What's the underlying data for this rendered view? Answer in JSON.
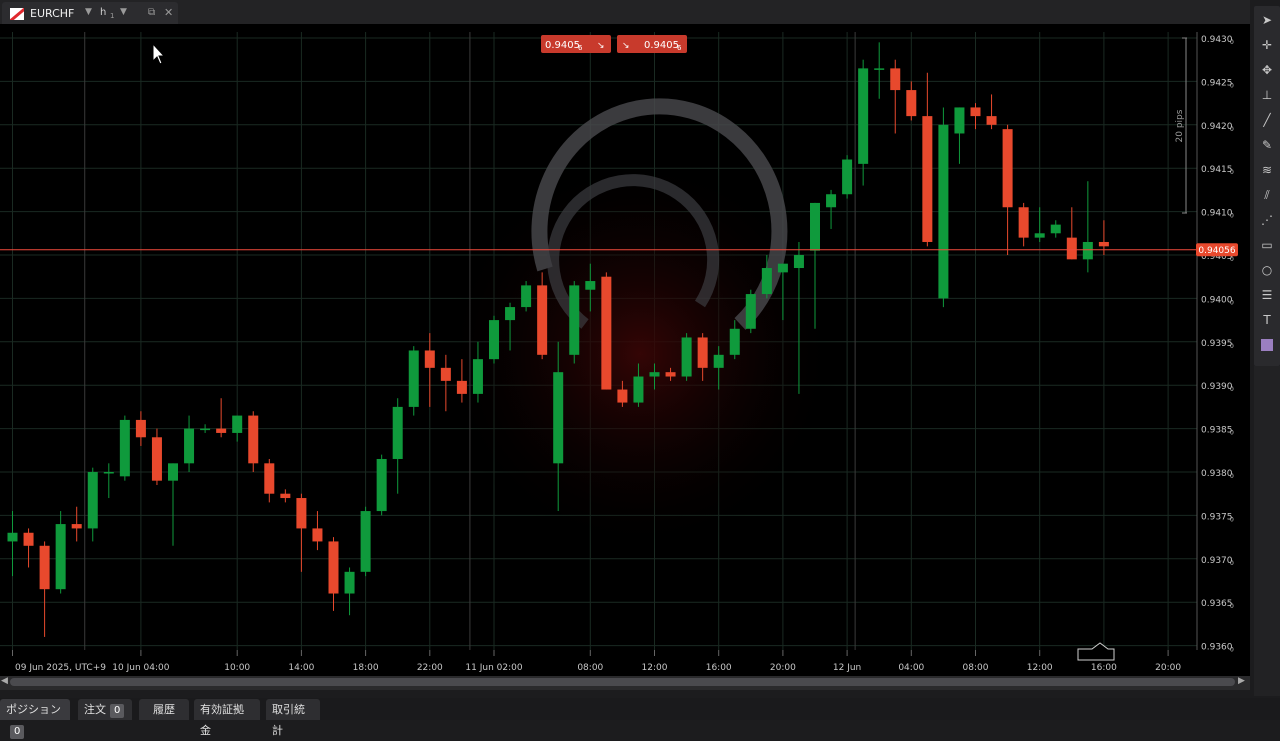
{
  "top_tab": {
    "symbol": "EURCHF",
    "timeframe": "h",
    "timeframe_sub": "1"
  },
  "colors": {
    "bull": "#0f9a3c",
    "bear": "#e8492d",
    "price_line": "#ef4b3c",
    "grid": "#1a2a22",
    "axis_text": "#c8c8c8"
  },
  "price_badges": {
    "sell": "0.9405",
    "sell_sub": "6",
    "buy": "0.9405",
    "buy_sub": "6"
  },
  "bottom_tabs": [
    {
      "label": "ポジション",
      "count": "0"
    },
    {
      "label": "注文",
      "count": "0"
    },
    {
      "label": "履歴"
    },
    {
      "label": "有効証拠金"
    },
    {
      "label": "取引統計"
    }
  ],
  "tools": [
    "cursor-icon",
    "crosshair-icon",
    "move-icon",
    "measure-icon",
    "trendline-icon",
    "brush-icon",
    "fibonacci-icon",
    "pitchfork-icon",
    "channel-icon",
    "rectangle-icon",
    "ellipse-icon",
    "equidistant-icon",
    "text-icon",
    "color-swatch-icon"
  ],
  "chart_data": {
    "type": "candlestick",
    "symbol": "EURCHF",
    "timeframe": "h1",
    "ylim": [
      0.93585,
      0.94305
    ],
    "y_ticks": [
      "0.9430",
      "0.9425",
      "0.9420",
      "0.9415",
      "0.9410",
      "0.9405",
      "0.9400",
      "0.9395",
      "0.9390",
      "0.9385",
      "0.9380",
      "0.9375",
      "0.9370",
      "0.9365",
      "0.9360"
    ],
    "y_tick_sub": "0",
    "current_price": "0.94056",
    "range_label": "20 pips",
    "x_labels": [
      {
        "label": "09 Jun 2025, UTC+9",
        "bar": 0
      },
      {
        "label": "10 Jun 04:00",
        "bar": 8
      },
      {
        "label": "10:00",
        "bar": 14
      },
      {
        "label": "14:00",
        "bar": 18
      },
      {
        "label": "18:00",
        "bar": 22
      },
      {
        "label": "22:00",
        "bar": 26
      },
      {
        "label": "11 Jun 02:00",
        "bar": 30
      },
      {
        "label": "08:00",
        "bar": 36
      },
      {
        "label": "12:00",
        "bar": 40
      },
      {
        "label": "16:00",
        "bar": 44
      },
      {
        "label": "20:00",
        "bar": 48
      },
      {
        "label": "12 Jun",
        "bar": 52
      },
      {
        "label": "04:00",
        "bar": 56
      },
      {
        "label": "08:00",
        "bar": 60
      },
      {
        "label": "12:00",
        "bar": 64
      },
      {
        "label": "16:00",
        "bar": 68
      },
      {
        "label": "20:00",
        "bar": 72
      }
    ],
    "vlines_bars": [
      4,
      28,
      52
    ],
    "candles": [
      {
        "o": 0.9372,
        "h": 0.93755,
        "l": 0.9368,
        "c": 0.9373
      },
      {
        "o": 0.9373,
        "h": 0.93735,
        "l": 0.9369,
        "c": 0.93715
      },
      {
        "o": 0.93715,
        "h": 0.9372,
        "l": 0.9361,
        "c": 0.93665
      },
      {
        "o": 0.93665,
        "h": 0.93755,
        "l": 0.9366,
        "c": 0.9374
      },
      {
        "o": 0.9374,
        "h": 0.9376,
        "l": 0.9372,
        "c": 0.93735
      },
      {
        "o": 0.93735,
        "h": 0.93805,
        "l": 0.9372,
        "c": 0.938
      },
      {
        "o": 0.938,
        "h": 0.9381,
        "l": 0.9377,
        "c": 0.938
      },
      {
        "o": 0.93795,
        "h": 0.93865,
        "l": 0.9379,
        "c": 0.9386
      },
      {
        "o": 0.9386,
        "h": 0.9387,
        "l": 0.9383,
        "c": 0.9384
      },
      {
        "o": 0.9384,
        "h": 0.9385,
        "l": 0.93785,
        "c": 0.9379
      },
      {
        "o": 0.9379,
        "h": 0.9381,
        "l": 0.93715,
        "c": 0.9381
      },
      {
        "o": 0.9381,
        "h": 0.93865,
        "l": 0.938,
        "c": 0.9385
      },
      {
        "o": 0.9385,
        "h": 0.93855,
        "l": 0.93845,
        "c": 0.9385
      },
      {
        "o": 0.9385,
        "h": 0.93885,
        "l": 0.9384,
        "c": 0.93845
      },
      {
        "o": 0.93845,
        "h": 0.93865,
        "l": 0.93835,
        "c": 0.93865
      },
      {
        "o": 0.93865,
        "h": 0.9387,
        "l": 0.938,
        "c": 0.9381
      },
      {
        "o": 0.9381,
        "h": 0.93815,
        "l": 0.93765,
        "c": 0.93775
      },
      {
        "o": 0.93775,
        "h": 0.9378,
        "l": 0.93765,
        "c": 0.9377
      },
      {
        "o": 0.9377,
        "h": 0.93775,
        "l": 0.93685,
        "c": 0.93735
      },
      {
        "o": 0.93735,
        "h": 0.93755,
        "l": 0.9371,
        "c": 0.9372
      },
      {
        "o": 0.9372,
        "h": 0.93725,
        "l": 0.9364,
        "c": 0.9366
      },
      {
        "o": 0.9366,
        "h": 0.9369,
        "l": 0.93635,
        "c": 0.93685
      },
      {
        "o": 0.93685,
        "h": 0.9376,
        "l": 0.9368,
        "c": 0.93755
      },
      {
        "o": 0.93755,
        "h": 0.9382,
        "l": 0.9375,
        "c": 0.93815
      },
      {
        "o": 0.93815,
        "h": 0.93885,
        "l": 0.93775,
        "c": 0.93875
      },
      {
        "o": 0.93875,
        "h": 0.93945,
        "l": 0.93865,
        "c": 0.9394
      },
      {
        "o": 0.9394,
        "h": 0.9396,
        "l": 0.93875,
        "c": 0.9392
      },
      {
        "o": 0.9392,
        "h": 0.93935,
        "l": 0.9387,
        "c": 0.93905
      },
      {
        "o": 0.93905,
        "h": 0.9393,
        "l": 0.9388,
        "c": 0.9389
      },
      {
        "o": 0.9389,
        "h": 0.9395,
        "l": 0.9388,
        "c": 0.9393
      },
      {
        "o": 0.9393,
        "h": 0.9398,
        "l": 0.93925,
        "c": 0.93975
      },
      {
        "o": 0.93975,
        "h": 0.93995,
        "l": 0.9394,
        "c": 0.9399
      },
      {
        "o": 0.9399,
        "h": 0.9402,
        "l": 0.93985,
        "c": 0.94015
      },
      {
        "o": 0.94015,
        "h": 0.9403,
        "l": 0.9393,
        "c": 0.93935
      },
      {
        "o": 0.9381,
        "h": 0.9395,
        "l": 0.93755,
        "c": 0.93915
      },
      {
        "o": 0.93935,
        "h": 0.9402,
        "l": 0.93925,
        "c": 0.94015
      },
      {
        "o": 0.9401,
        "h": 0.9404,
        "l": 0.93985,
        "c": 0.9402
      },
      {
        "o": 0.94025,
        "h": 0.9403,
        "l": 0.93895,
        "c": 0.93895
      },
      {
        "o": 0.93895,
        "h": 0.93905,
        "l": 0.93875,
        "c": 0.9388
      },
      {
        "o": 0.9388,
        "h": 0.93925,
        "l": 0.93875,
        "c": 0.9391
      },
      {
        "o": 0.9391,
        "h": 0.93925,
        "l": 0.93895,
        "c": 0.93915
      },
      {
        "o": 0.93915,
        "h": 0.9392,
        "l": 0.93905,
        "c": 0.9391
      },
      {
        "o": 0.9391,
        "h": 0.9396,
        "l": 0.93905,
        "c": 0.93955
      },
      {
        "o": 0.93955,
        "h": 0.9396,
        "l": 0.93905,
        "c": 0.9392
      },
      {
        "o": 0.9392,
        "h": 0.93945,
        "l": 0.93895,
        "c": 0.93935
      },
      {
        "o": 0.93935,
        "h": 0.93975,
        "l": 0.9393,
        "c": 0.93965
      },
      {
        "o": 0.93965,
        "h": 0.9401,
        "l": 0.9396,
        "c": 0.94005
      },
      {
        "o": 0.94005,
        "h": 0.9405,
        "l": 0.94,
        "c": 0.94035
      },
      {
        "o": 0.9403,
        "h": 0.9404,
        "l": 0.93975,
        "c": 0.9404
      },
      {
        "o": 0.94035,
        "h": 0.94065,
        "l": 0.9389,
        "c": 0.9405
      },
      {
        "o": 0.94055,
        "h": 0.9411,
        "l": 0.93965,
        "c": 0.9411
      },
      {
        "o": 0.94105,
        "h": 0.94125,
        "l": 0.9408,
        "c": 0.9412
      },
      {
        "o": 0.9412,
        "h": 0.94165,
        "l": 0.94115,
        "c": 0.9416
      },
      {
        "o": 0.94155,
        "h": 0.94275,
        "l": 0.9413,
        "c": 0.94265
      },
      {
        "o": 0.94265,
        "h": 0.94295,
        "l": 0.9423,
        "c": 0.94265
      },
      {
        "o": 0.94265,
        "h": 0.94275,
        "l": 0.9419,
        "c": 0.9424
      },
      {
        "o": 0.9424,
        "h": 0.9425,
        "l": 0.94205,
        "c": 0.9421
      },
      {
        "o": 0.9421,
        "h": 0.9426,
        "l": 0.9406,
        "c": 0.94065
      },
      {
        "o": 0.94,
        "h": 0.9422,
        "l": 0.9399,
        "c": 0.942
      },
      {
        "o": 0.9419,
        "h": 0.9422,
        "l": 0.94155,
        "c": 0.9422
      },
      {
        "o": 0.9422,
        "h": 0.94225,
        "l": 0.94195,
        "c": 0.9421
      },
      {
        "o": 0.9421,
        "h": 0.94235,
        "l": 0.94195,
        "c": 0.942
      },
      {
        "o": 0.94195,
        "h": 0.942,
        "l": 0.9405,
        "c": 0.94105
      },
      {
        "o": 0.94105,
        "h": 0.9411,
        "l": 0.9406,
        "c": 0.9407
      },
      {
        "o": 0.9407,
        "h": 0.94105,
        "l": 0.94065,
        "c": 0.94075
      },
      {
        "o": 0.94075,
        "h": 0.9409,
        "l": 0.9407,
        "c": 0.94085
      },
      {
        "o": 0.9407,
        "h": 0.94105,
        "l": 0.94045,
        "c": 0.94045
      },
      {
        "o": 0.94045,
        "h": 0.94135,
        "l": 0.9403,
        "c": 0.94065
      },
      {
        "o": 0.94065,
        "h": 0.9409,
        "l": 0.9405,
        "c": 0.9406
      }
    ]
  }
}
